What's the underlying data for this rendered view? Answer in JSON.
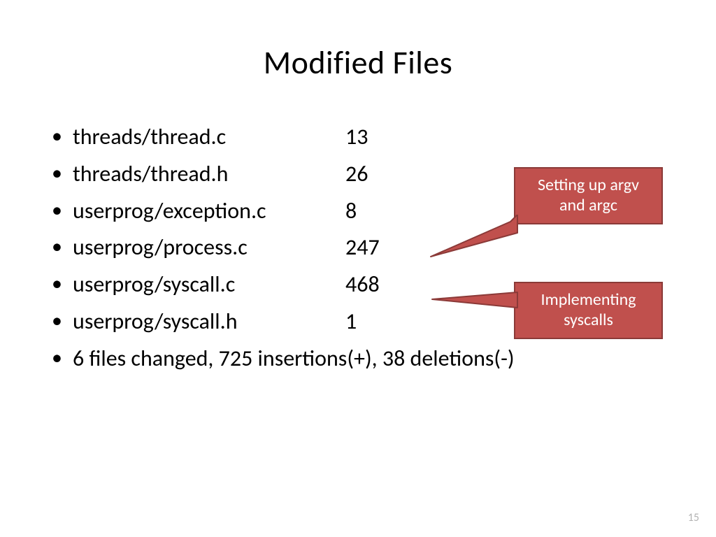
{
  "title": "Modified Files",
  "files": [
    {
      "name": "threads/thread.c",
      "count": "13"
    },
    {
      "name": "threads/thread.h",
      "count": "26"
    },
    {
      "name": "userprog/exception.c",
      "count": "8"
    },
    {
      "name": "userprog/process.c",
      "count": "247"
    },
    {
      "name": "userprog/syscall.c",
      "count": "468"
    },
    {
      "name": "userprog/syscall.h",
      "count": "1"
    }
  ],
  "summary": "6 files changed, 725 insertions(+), 38 deletions(-)",
  "callouts": {
    "argv": "Setting up argv and argc",
    "syscalls": "Implementing syscalls"
  },
  "page_number": "15"
}
